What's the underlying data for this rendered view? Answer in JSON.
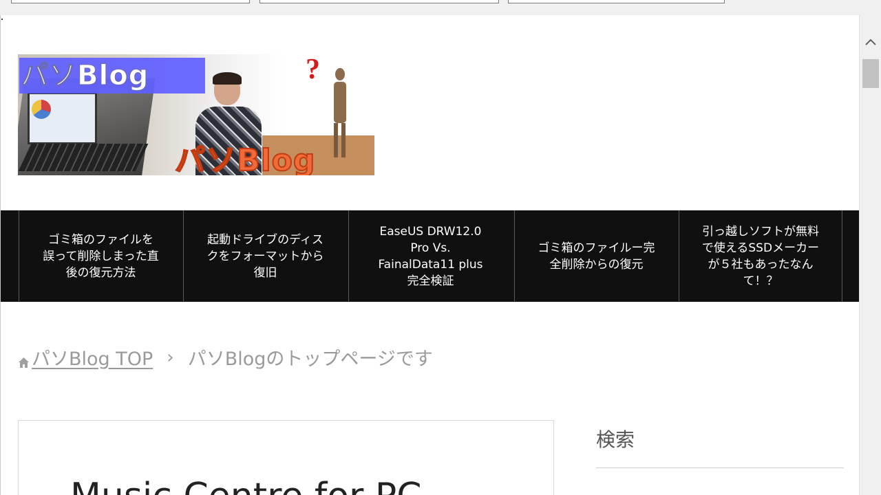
{
  "site": {
    "logo_text_top": "パソBlog",
    "logo_text_bottom": "パソBlog",
    "question_mark": "?"
  },
  "nav": {
    "items": [
      {
        "lines": [
          "ゴミ箱のファイルを",
          "誤って削除しまった直",
          "後の復元方法"
        ]
      },
      {
        "lines": [
          "起動ドライブのディス",
          "クをフォーマットから",
          "復旧"
        ]
      },
      {
        "lines": [
          "EaseUS DRW12.0",
          "Pro Vs.",
          "FainalData11 plus",
          "完全検証"
        ]
      },
      {
        "lines": [
          "ゴミ箱のファイルー完",
          "全削除からの復元"
        ]
      },
      {
        "lines": [
          "引っ越しソフトが無料",
          "で使えるSSDメーカー",
          "が５社もあったなん",
          "て！？"
        ]
      }
    ]
  },
  "breadcrumb": {
    "home_label": "パソBlog TOP",
    "separator": "›",
    "current": "パソBlogのトップページです"
  },
  "article": {
    "title_partial": "Music Centre for PC"
  },
  "sidebar": {
    "search_title": "検索"
  },
  "colors": {
    "nav_bg": "#101010",
    "logo_blue": "#6060ff",
    "logo_orange": "#f06a3a",
    "breadcrumb_text": "#9a9a9a"
  },
  "icons": {
    "home": "home-icon",
    "scroll_up": "chevron-up-icon"
  }
}
